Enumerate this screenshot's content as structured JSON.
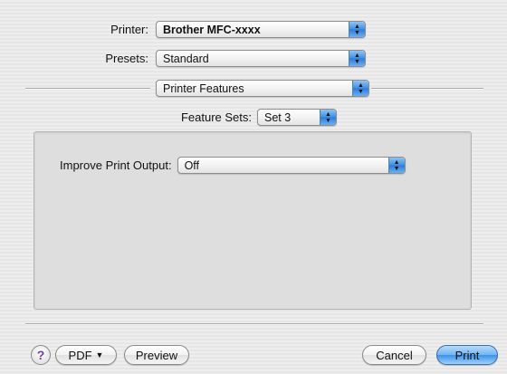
{
  "printer": {
    "label": "Printer:",
    "value": "Brother MFC-xxxx"
  },
  "presets": {
    "label": "Presets:",
    "value": "Standard"
  },
  "panel_selector": {
    "value": "Printer Features"
  },
  "feature_sets": {
    "label": "Feature Sets:",
    "value": "Set 3"
  },
  "improve_print_output": {
    "label": "Improve Print Output:",
    "value": "Off"
  },
  "buttons": {
    "help": "?",
    "pdf": "PDF",
    "pdf_arrow": "▼",
    "preview": "Preview",
    "cancel": "Cancel",
    "print": "Print"
  },
  "icons": {
    "popup_arrows": "updown-arrows-icon",
    "help": "question-mark-icon"
  },
  "colors": {
    "accent": "#3b93ea",
    "background": "#ececec",
    "group_box": "#dedede"
  }
}
